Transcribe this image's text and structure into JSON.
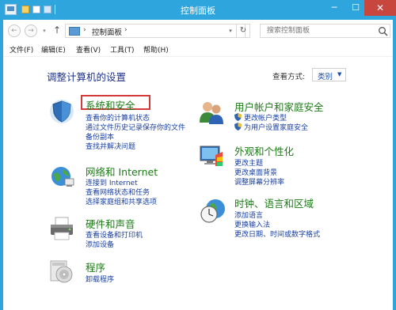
{
  "window": {
    "title": "控制面板",
    "min_label": "─",
    "max_label": "☐",
    "close_label": "✕"
  },
  "nav": {
    "back_label": "←",
    "forward_label": "→",
    "history_label": "▾",
    "up_label": "↑"
  },
  "address": {
    "separator": "›",
    "path": "控制面板",
    "trailing_separator": "›",
    "dropdown_label": "▾",
    "refresh_label": "↻"
  },
  "search": {
    "placeholder": "搜索控制面板"
  },
  "menu": {
    "file": "文件(F)",
    "edit": "编辑(E)",
    "view": "查看(V)",
    "tools": "工具(T)",
    "help": "帮助(H)"
  },
  "page": {
    "title": "调整计算机的设置",
    "view_label": "查看方式:",
    "view_value": "类别",
    "view_arrow": "▼"
  },
  "categories": {
    "system_security": {
      "title": "系统和安全",
      "icon": "shield-icon",
      "links": [
        "查看你的计算机状态",
        "通过文件历史记录保存你的文件",
        "备份副本",
        "查找并解决问题"
      ]
    },
    "network": {
      "title": "网络和 Internet",
      "icon": "network-globe-icon",
      "links": [
        "连接到 Internet",
        "查看网络状态和任务",
        "选择家庭组和共享选项"
      ]
    },
    "hardware": {
      "title": "硬件和声音",
      "icon": "printer-icon",
      "links": [
        "查看设备和打印机",
        "添加设备"
      ]
    },
    "programs": {
      "title": "程序",
      "icon": "programs-disc-icon",
      "links": [
        "卸载程序"
      ]
    },
    "user_accounts": {
      "title": "用户帐户和家庭安全",
      "icon": "users-icon",
      "links": [
        "更改帐户类型",
        "为用户设置家庭安全"
      ]
    },
    "appearance": {
      "title": "外观和个性化",
      "icon": "appearance-monitor-icon",
      "links": [
        "更改主题",
        "更改桌面背景",
        "调整屏幕分辨率"
      ]
    },
    "clock_region": {
      "title": "时钟、语言和区域",
      "icon": "clock-globe-icon",
      "links": [
        "添加语言",
        "更换输入法",
        "更改日期、时间或数字格式"
      ]
    }
  },
  "colors": {
    "titlebar": "#2ea6dd",
    "category_title": "#1c7b16",
    "link": "#1a40a0",
    "page_title": "#1e3287",
    "highlight": "#d33b3b"
  }
}
